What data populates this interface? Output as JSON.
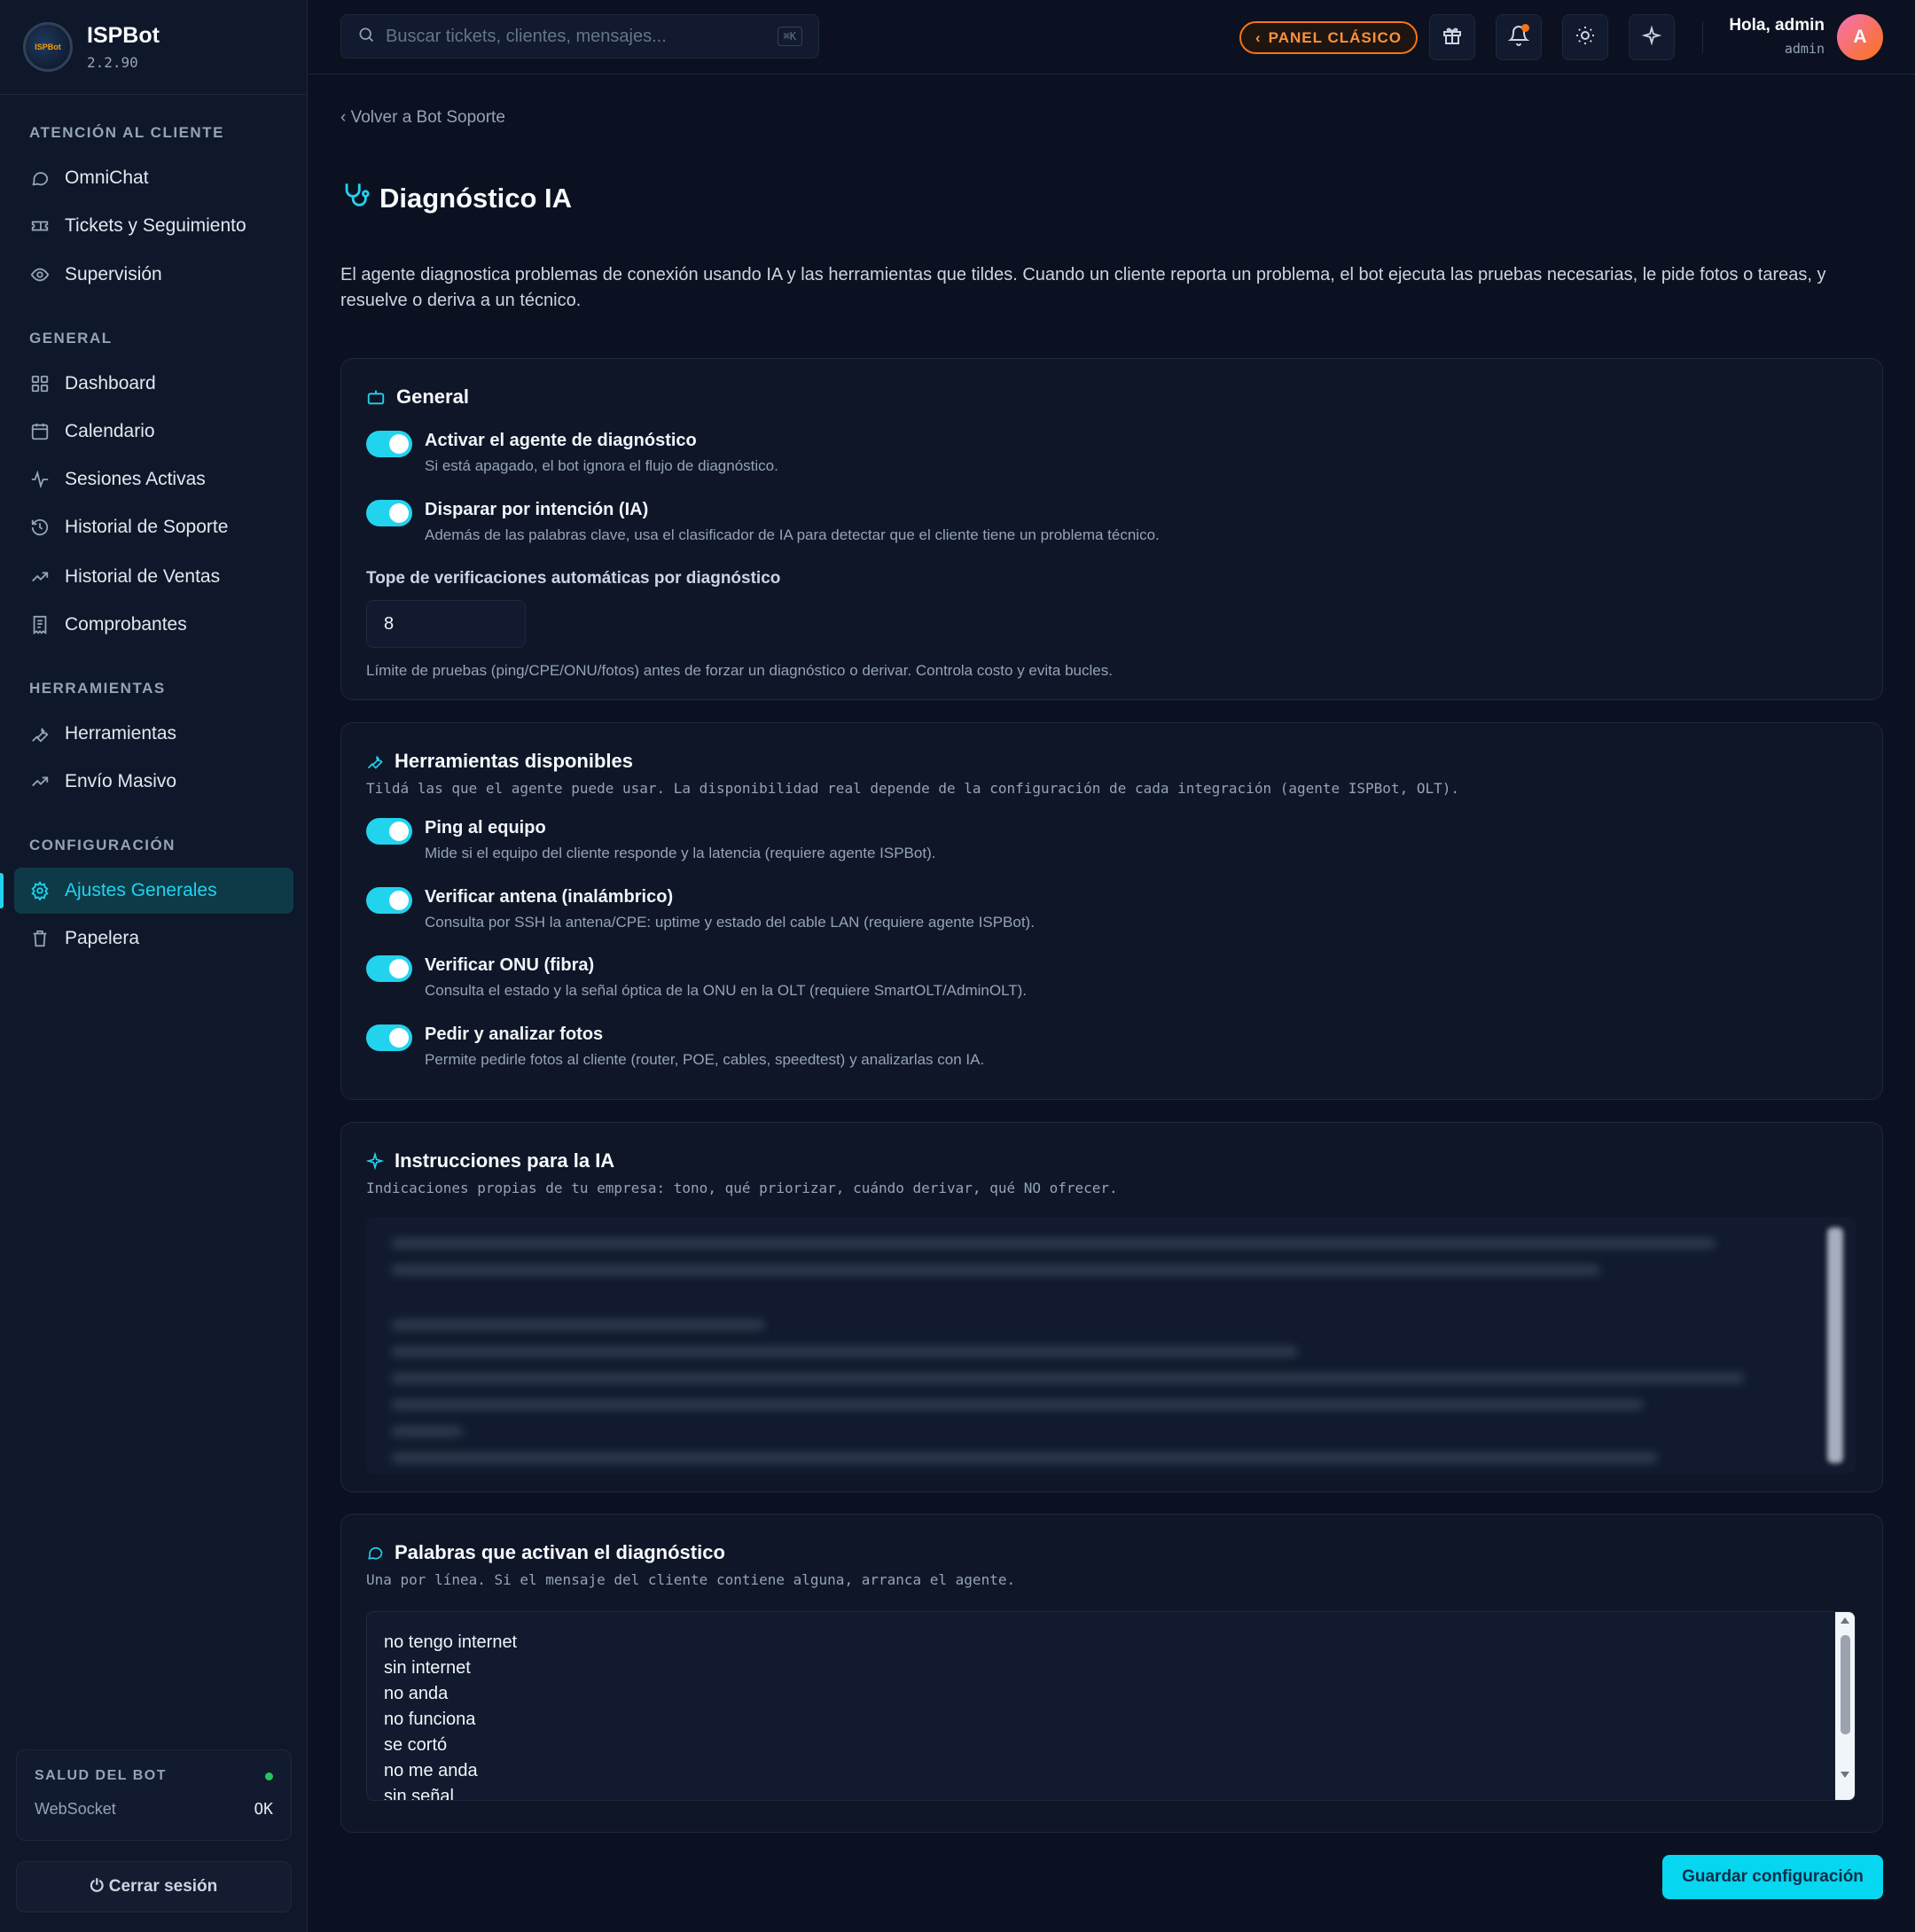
{
  "brand": {
    "name": "ISPBot",
    "version": "2.2.90",
    "logo_text": "ISPBot"
  },
  "sidebar": {
    "sections": [
      {
        "title": "ATENCIÓN AL CLIENTE",
        "items": [
          {
            "label": "OmniChat",
            "icon": "chat-bubble-icon"
          },
          {
            "label": "Tickets y Seguimiento",
            "icon": "ticket-icon"
          },
          {
            "label": "Supervisión",
            "icon": "eye-icon"
          }
        ]
      },
      {
        "title": "GENERAL",
        "items": [
          {
            "label": "Dashboard",
            "icon": "grid-icon"
          },
          {
            "label": "Calendario",
            "icon": "calendar-icon"
          },
          {
            "label": "Sesiones Activas",
            "icon": "activity-icon"
          },
          {
            "label": "Historial de Soporte",
            "icon": "history-icon"
          },
          {
            "label": "Historial de Ventas",
            "icon": "trending-up-icon"
          },
          {
            "label": "Comprobantes",
            "icon": "receipt-icon"
          }
        ]
      },
      {
        "title": "HERRAMIENTAS",
        "items": [
          {
            "label": "Herramientas",
            "icon": "wrench-icon"
          },
          {
            "label": "Envío Masivo",
            "icon": "trending-up-icon"
          }
        ]
      },
      {
        "title": "CONFIGURACIÓN",
        "items": [
          {
            "label": "Ajustes Generales",
            "icon": "gear-icon",
            "active": true
          },
          {
            "label": "Papelera",
            "icon": "trash-icon"
          }
        ]
      }
    ],
    "health": {
      "title": "SALUD DEL BOT",
      "websocket_label": "WebSocket",
      "websocket_status": "OK",
      "status_color": "#22c55e"
    },
    "logout_label": "Cerrar sesión"
  },
  "topbar": {
    "search_placeholder": "Buscar tickets, clientes, mensajes...",
    "search_shortcut": "⌘K",
    "panel_button": "PANEL CLÁSICO",
    "greeting": "Hola, admin",
    "role": "admin",
    "avatar_initial": "A"
  },
  "page": {
    "back_link": "‹ Volver a Bot Soporte",
    "title": "Diagnóstico IA",
    "description": "El agente diagnostica problemas de conexión usando IA y las herramientas que tildes. Cuando un cliente reporta un problema, el bot ejecuta las pruebas necesarias, le pide fotos o tareas, y resuelve o deriva a un técnico."
  },
  "general": {
    "title": "General",
    "toggles": [
      {
        "label": "Activar el agente de diagnóstico",
        "help": "Si está apagado, el bot ignora el flujo de diagnóstico.",
        "on": true
      },
      {
        "label": "Disparar por intención (IA)",
        "help": "Además de las palabras clave, usa el clasificador de IA para detectar que el cliente tiene un problema técnico.",
        "on": true
      }
    ],
    "max_checks_label": "Tope de verificaciones automáticas por diagnóstico",
    "max_checks_value": "8",
    "max_checks_help": "Límite de pruebas (ping/CPE/ONU/fotos) antes de forzar un diagnóstico o derivar. Controla costo y evita bucles."
  },
  "tools": {
    "title": "Herramientas disponibles",
    "subtitle": "Tildá las que el agente puede usar. La disponibilidad real depende de la configuración de cada integración (agente ISPBot, OLT).",
    "toggles": [
      {
        "label": "Ping al equipo",
        "help": "Mide si el equipo del cliente responde y la latencia (requiere agente ISPBot).",
        "on": true
      },
      {
        "label": "Verificar antena (inalámbrico)",
        "help": "Consulta por SSH la antena/CPE: uptime y estado del cable LAN (requiere agente ISPBot).",
        "on": true
      },
      {
        "label": "Verificar ONU (fibra)",
        "help": "Consulta el estado y la señal óptica de la ONU en la OLT (requiere SmartOLT/AdminOLT).",
        "on": true
      },
      {
        "label": "Pedir y analizar fotos",
        "help": "Permite pedirle fotos al cliente (router, POE, cables, speedtest) y analizarlas con IA.",
        "on": true
      }
    ]
  },
  "instructions": {
    "title": "Instrucciones para la IA",
    "subtitle": "Indicaciones propias de tu empresa: tono, qué priorizar, cuándo derivar, qué NO ofrecer."
  },
  "keywords": {
    "title": "Palabras que activan el diagnóstico",
    "subtitle": "Una por línea. Si el mensaje del cliente contiene alguna, arranca el agente.",
    "items": [
      "no tengo internet",
      "sin internet",
      "no anda",
      "no funciona",
      "se cortó",
      "no me anda",
      "sin señal"
    ]
  },
  "save_label": "Guardar configuración",
  "colors": {
    "accent": "#22d3ee",
    "orange": "#f97316",
    "background": "#0b1120"
  }
}
